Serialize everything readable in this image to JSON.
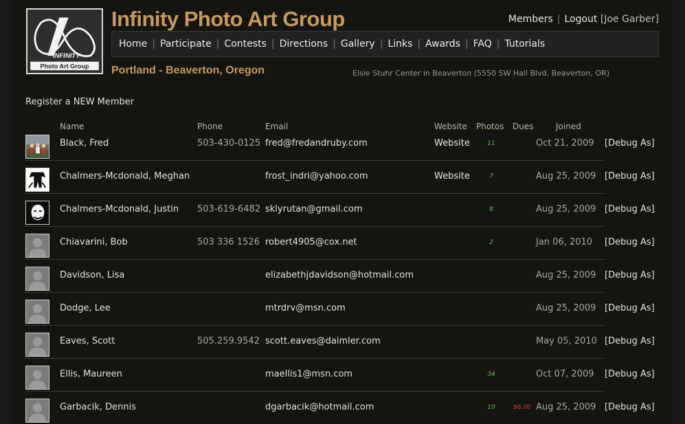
{
  "header": {
    "site_title": "Infinity Photo Art Group",
    "logo_text_1": "INFINITY",
    "logo_text_2": "Photo Art Group",
    "location": "Portland - Beaverton, Oregon",
    "venue": "Elsie Stuhr Center in Beaverton (5550 SW Hall Blvd, Beaverton, OR)"
  },
  "usernav": {
    "members": "Members",
    "logout": "Logout",
    "user": "[Joe Garber]"
  },
  "nav": [
    "Home",
    "Participate",
    "Contests",
    "Directions",
    "Gallery",
    "Links",
    "Awards",
    "FAQ",
    "Tutorials"
  ],
  "register_link": "Register a NEW Member",
  "table": {
    "headers": {
      "name": "Name",
      "phone": "Phone",
      "email": "Email",
      "website": "Website",
      "photos": "Photos",
      "dues": "Dues",
      "joined": "Joined"
    },
    "rows": [
      {
        "avatar": "photo-family",
        "name": "Black, Fred",
        "phone": "503-430-0125",
        "email": "fred@fredandruby.com",
        "website": "Website",
        "photos": "11",
        "dues": "",
        "joined": "Oct 21, 2009",
        "debug": "[Debug As]"
      },
      {
        "avatar": "photo-bw-figure",
        "name": "Chalmers-Mcdonald, Meghan",
        "phone": "",
        "email": "frost_indri@yahoo.com",
        "website": "Website",
        "photos": "7",
        "dues": "",
        "joined": "Aug 25, 2009",
        "debug": "[Debug As]"
      },
      {
        "avatar": "photo-bw-face",
        "name": "Chalmers-Mcdonald, Justin",
        "phone": "503-619-6482",
        "email": "sklyrutan@gmail.com",
        "website": "",
        "photos": "8",
        "dues": "",
        "joined": "Aug 25, 2009",
        "debug": "[Debug As]"
      },
      {
        "avatar": "placeholder",
        "name": "Chiavarini, Bob",
        "phone": "503 336 1526",
        "email": "robert4905@cox.net",
        "website": "",
        "photos": "2",
        "dues": "",
        "joined": "Jan 06, 2010",
        "debug": "[Debug As]"
      },
      {
        "avatar": "placeholder",
        "name": "Davidson, Lisa",
        "phone": "",
        "email": "elizabethjdavidson@hotmail.com",
        "website": "",
        "photos": "",
        "dues": "",
        "joined": "Aug 25, 2009",
        "debug": "[Debug As]"
      },
      {
        "avatar": "placeholder",
        "name": "Dodge, Lee",
        "phone": "",
        "email": "mtrdrv@msn.com",
        "website": "",
        "photos": "",
        "dues": "",
        "joined": "Aug 25, 2009",
        "debug": "[Debug As]"
      },
      {
        "avatar": "placeholder",
        "name": "Eaves, Scott",
        "phone": "505.259.9542",
        "email": "scott.eaves@daimler.com",
        "website": "",
        "photos": "",
        "dues": "",
        "joined": "May 05, 2010",
        "debug": "[Debug As]"
      },
      {
        "avatar": "placeholder",
        "name": "Ellis, Maureen",
        "phone": "",
        "email": "maellis1@msn.com",
        "website": "",
        "photos": "34",
        "dues": "",
        "joined": "Oct 07, 2009",
        "debug": "[Debug As]"
      },
      {
        "avatar": "placeholder",
        "name": "Garbacik, Dennis",
        "phone": "",
        "email": "dgarbacik@hotmail.com",
        "website": "",
        "photos": "10",
        "dues": "$6.00",
        "joined": "Aug 25, 2009",
        "debug": "[Debug As]"
      }
    ]
  },
  "colors": {
    "accent": "#c8995c",
    "photos_count": "#66c455",
    "dues_owed": "#e03030"
  }
}
